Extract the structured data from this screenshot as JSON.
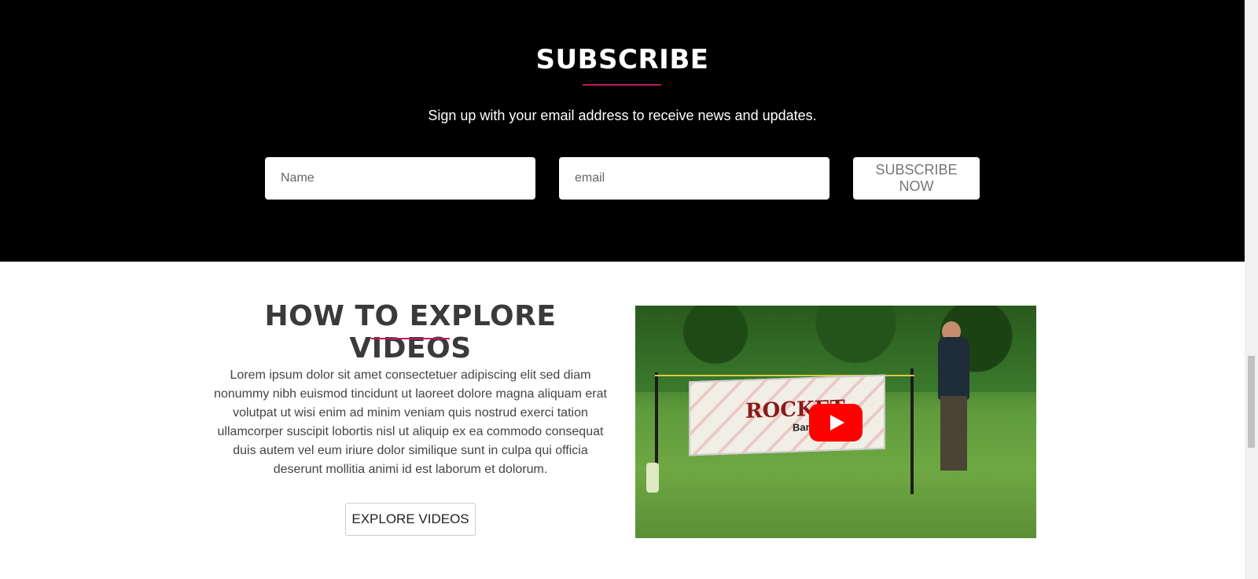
{
  "subscribe": {
    "title": "SUBSCRIBE",
    "text": "Sign up with your email address to receive news and updates.",
    "name_placeholder": "Name",
    "email_placeholder": "email",
    "button_label": "SUBSCRIBE NOW"
  },
  "explore": {
    "title": "HOW TO EXPLORE VIDEOS",
    "text": "Lorem ipsum dolor sit amet consectetuer adipiscing elit sed diam nonummy nibh euismod tincidunt ut laoreet dolore magna aliquam erat volutpat ut wisi enim ad minim veniam quis nostrud exerci tation ullamcorper suscipit lobortis nisl ut aliquip ex ea commodo consequat duis autem vel eum iriure dolor similique sunt in culpa qui officia deserunt mollitia animi id est laborum et dolorum.",
    "button_label": "EXPLORE VIDEOS"
  },
  "video": {
    "banner_text": "ROCKET",
    "banner_subtext": "Banner",
    "play_icon": "youtube-play-icon"
  },
  "colors": {
    "accent": "#c2185b",
    "dark_bg": "#000000",
    "play_red": "#ff0000"
  }
}
